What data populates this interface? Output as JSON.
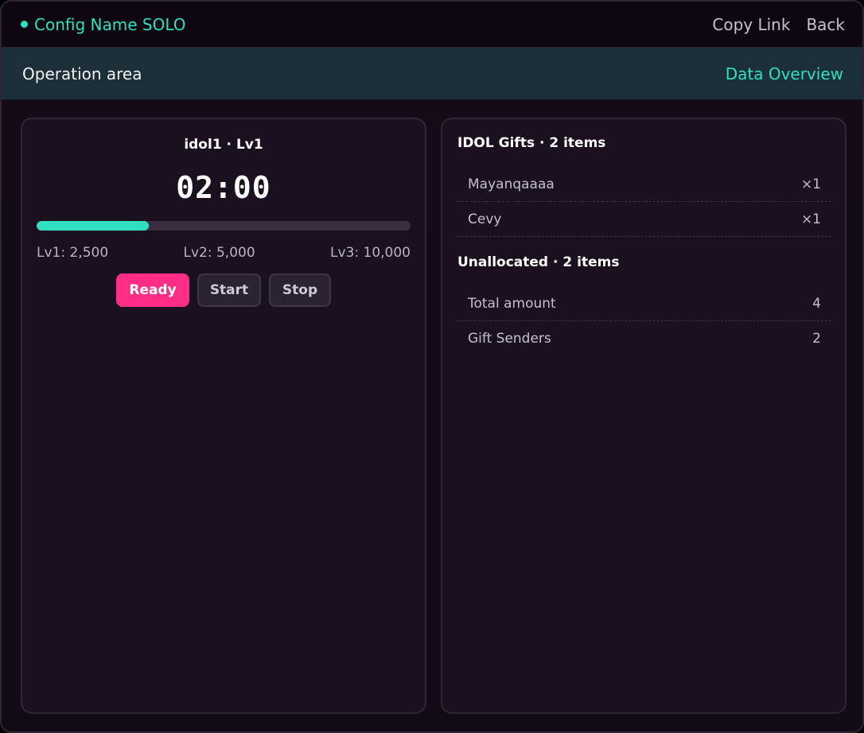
{
  "header": {
    "title": "Config Name SOLO",
    "copy_link": "Copy Link",
    "back": "Back",
    "accent_color": "#2fe0c0"
  },
  "subheader": {
    "title": "Operation area",
    "data_overview": "Data Overview"
  },
  "operation": {
    "idol_title": "idol1 · Lv1",
    "timer": "02:00",
    "progress_fraction": 0.3,
    "levels": [
      "Lv1: 2,500",
      "Lv2: 5,000",
      "Lv3: 10,000"
    ],
    "buttons": {
      "ready": "Ready",
      "start": "Start",
      "stop": "Stop"
    },
    "ready_color": "#ff2d86"
  },
  "overview": {
    "gifts_title": "IDOL Gifts · 2 items",
    "gifts": [
      {
        "name": "Mayanqaaaa",
        "count": "×1"
      },
      {
        "name": "Cevy",
        "count": "×1"
      }
    ],
    "unallocated_title": "Unallocated · 2 items",
    "unallocated": [
      {
        "label": "Total amount",
        "value": "4"
      },
      {
        "label": "Gift Senders",
        "value": "2"
      }
    ]
  }
}
